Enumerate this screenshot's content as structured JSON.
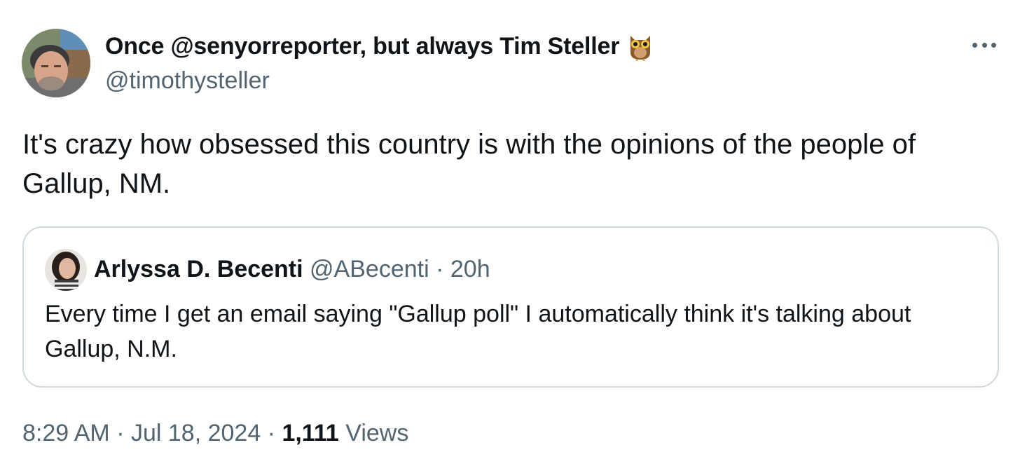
{
  "author": {
    "display_name": "Once @senyorreporter, but always Tim Steller",
    "emoji_icon": "owl-emoji",
    "handle": "@timothysteller",
    "avatar_icon": "man-avatar"
  },
  "menu_icon": "more-horizontal-icon",
  "tweet": {
    "text": "It's crazy how obsessed this country is with the opinions of the people of Gallup, NM."
  },
  "quoted_tweet": {
    "avatar_icon": "woman-avatar",
    "display_name": "Arlyssa D. Becenti",
    "handle": "@ABecenti",
    "separator": "·",
    "time": "20h",
    "text": "Every time I get an email saying \"Gallup poll\" I automatically think it's talking about Gallup, N.M."
  },
  "meta": {
    "time": "8:29 AM",
    "separator1": "·",
    "date": "Jul 18, 2024",
    "separator2": "·",
    "views_count": "1,111",
    "views_label": "Views"
  },
  "colors": {
    "text_primary": "#0f1419",
    "text_secondary": "#536471",
    "border": "#cfd9de"
  }
}
